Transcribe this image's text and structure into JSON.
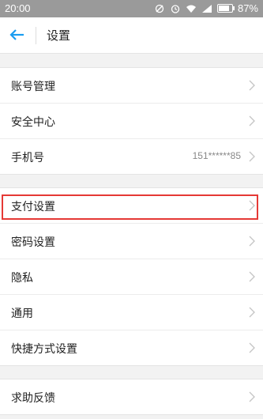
{
  "status_bar": {
    "time": "20:00",
    "battery_percent": "87%",
    "icons": [
      "no-signal-icon",
      "alarm-icon",
      "wifi-icon",
      "cellular-icon",
      "battery-icon"
    ]
  },
  "header": {
    "title": "设置",
    "back_icon": "back-arrow-icon",
    "accent_color": "#1a9cf0"
  },
  "groups": [
    {
      "items": [
        {
          "label": "账号管理"
        },
        {
          "label": "安全中心"
        },
        {
          "label": "手机号",
          "value": "151******85"
        }
      ]
    },
    {
      "items": [
        {
          "label": "支付设置",
          "highlighted": true
        },
        {
          "label": "密码设置"
        },
        {
          "label": "隐私"
        },
        {
          "label": "通用"
        },
        {
          "label": "快捷方式设置"
        }
      ]
    },
    {
      "items": [
        {
          "label": "求助反馈"
        }
      ]
    }
  ],
  "highlight_color": "#e53935"
}
